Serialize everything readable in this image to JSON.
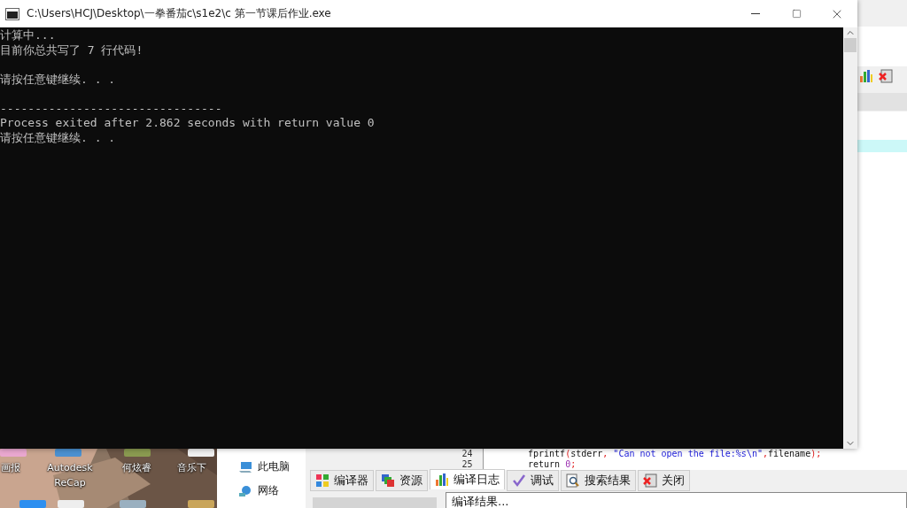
{
  "desktop": {
    "icons": [
      {
        "label": "画报"
      },
      {
        "label": "Autodesk ReCap"
      },
      {
        "label": "何炫睿"
      },
      {
        "label": "音乐下"
      }
    ]
  },
  "explorer": {
    "items": [
      {
        "label": "此电脑",
        "kind": "computer"
      },
      {
        "label": "网络",
        "kind": "network"
      }
    ]
  },
  "ide": {
    "code_lines": [
      {
        "number": "24",
        "tokens": [
          {
            "text": "fprintf",
            "kind": "plain"
          },
          {
            "text": "(",
            "kind": "punct"
          },
          {
            "text": "stderr",
            "kind": "plain"
          },
          {
            "text": ",",
            "kind": "punct"
          },
          {
            "text": " \"Can not open the file:%s\\n\"",
            "kind": "string"
          },
          {
            "text": ",",
            "kind": "punct"
          },
          {
            "text": "filename",
            "kind": "plain"
          },
          {
            "text": ");",
            "kind": "punct"
          }
        ]
      },
      {
        "number": "25",
        "tokens": [
          {
            "text": "return ",
            "kind": "plain"
          },
          {
            "text": "0",
            "kind": "number"
          },
          {
            "text": ";",
            "kind": "punct"
          }
        ]
      }
    ],
    "tabs": [
      {
        "label": "编译器",
        "kind": "grid",
        "selected": false
      },
      {
        "label": "资源",
        "kind": "layers",
        "selected": false
      },
      {
        "label": "编译日志",
        "kind": "chart",
        "selected": true
      },
      {
        "label": "调试",
        "kind": "check",
        "selected": false
      },
      {
        "label": "搜索结果",
        "kind": "search",
        "selected": false
      },
      {
        "label": "关闭",
        "kind": "close",
        "selected": false
      }
    ],
    "output": "编译结果..."
  },
  "console": {
    "title": "C:\\Users\\HCJ\\Desktop\\一拳番茄c\\s1e2\\c 第一节课后作业.exe",
    "lines": [
      {
        "text": "计算中...",
        "blank_before": false
      },
      {
        "text": "目前你总共写了 7 行代码!",
        "blank_before": false
      },
      {
        "text": "请按任意键继续. . .",
        "blank_before": true
      },
      {
        "text": "--------------------------------",
        "blank_before": true
      },
      {
        "text": "Process exited after 2.862 seconds with return value 0",
        "blank_before": false
      },
      {
        "text": "请按任意键继续. . .",
        "blank_before": false
      }
    ]
  }
}
